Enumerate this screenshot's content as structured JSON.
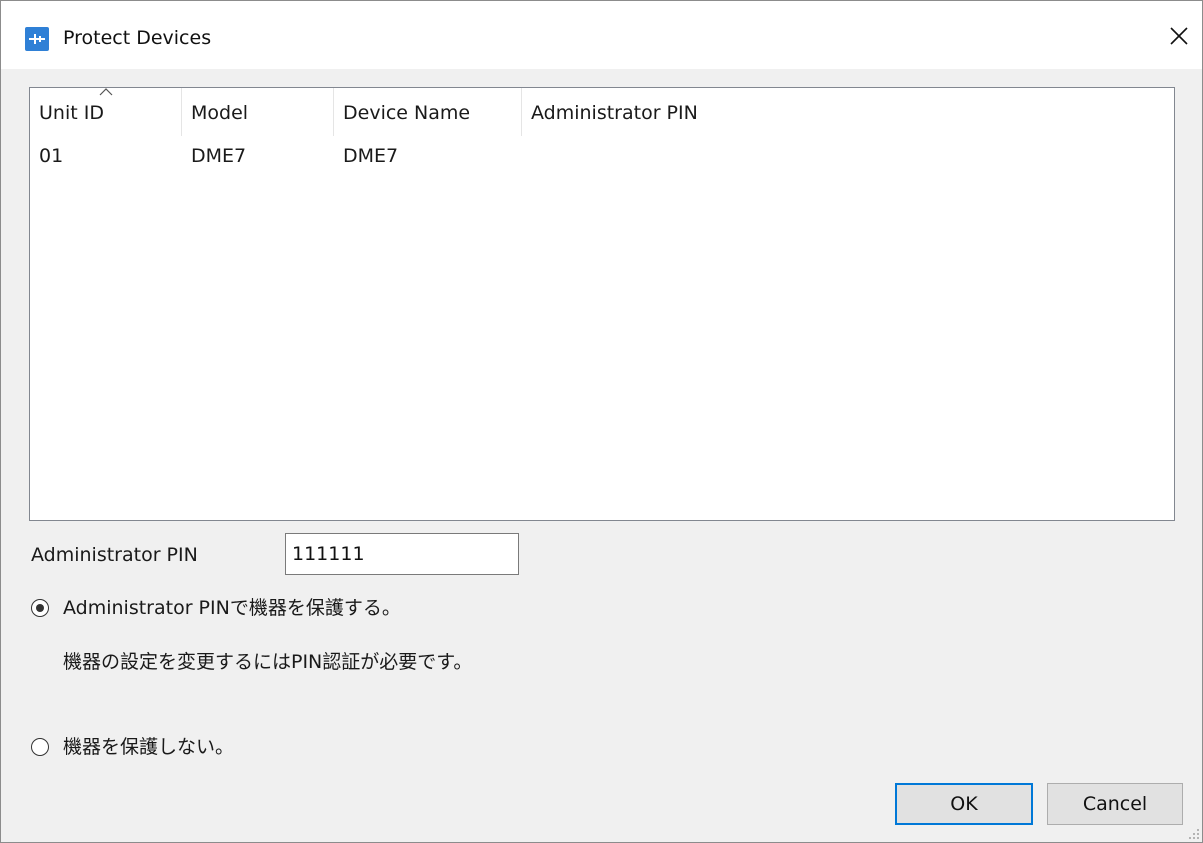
{
  "window": {
    "title": "Protect Devices",
    "icon": "app-icon",
    "close_icon": "close-icon"
  },
  "list": {
    "columns": [
      {
        "label": "Unit ID",
        "sorted": "ascending"
      },
      {
        "label": "Model"
      },
      {
        "label": "Device Name"
      },
      {
        "label": "Administrator PIN"
      }
    ],
    "rows": [
      {
        "unit_id": "01",
        "model": "DME7",
        "device_name": "DME7",
        "admin_pin": ""
      }
    ]
  },
  "pin_field": {
    "label": "Administrator PIN",
    "value": "111111"
  },
  "options": {
    "protect": {
      "label": "Administrator PINで機器を保護する。",
      "description": "機器の設定を変更するにはPIN認証が必要です。",
      "selected": true
    },
    "no_protect": {
      "label": "機器を保護しない。",
      "selected": false
    }
  },
  "buttons": {
    "ok": "OK",
    "cancel": "Cancel"
  },
  "colors": {
    "accent": "#0078d7",
    "app_icon": "#2f80d6"
  }
}
